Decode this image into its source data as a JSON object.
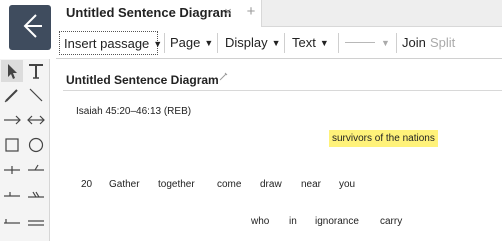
{
  "tab": {
    "title": "Untitled Sentence Diagram",
    "close_glyph": "×",
    "add_glyph": "+"
  },
  "toolbar": {
    "insert_passage": "Insert passage",
    "page": "Page",
    "display": "Display",
    "text": "Text",
    "join": "Join",
    "split": "Split",
    "caret_glyph": "▼"
  },
  "palette": {
    "tools": [
      "pointer-icon",
      "text-tool-icon",
      "pencil-icon",
      "line-icon",
      "arrow-icon",
      "double-arrow-icon",
      "rectangle-icon",
      "circle-icon",
      "horizontal-tick-icon",
      "slant-tick-icon",
      "baseline-icon",
      "slash-baseline-icon",
      "bracket-baseline-icon"
    ]
  },
  "canvas": {
    "doc_title": "Untitled Sentence Diagram",
    "reference": "Isaiah 45:20–46:13 (REB)",
    "highlighted_phrase": "survivors of the nations",
    "line1": [
      "20",
      "Gather",
      "together",
      "come",
      "draw",
      "near",
      "you"
    ],
    "line2": [
      "who",
      "in",
      "ignorance",
      "carry"
    ]
  },
  "colors": {
    "logo_bg": "#3f4c5e",
    "highlight": "#fff27a",
    "toolbar_disabled": "#aaaaaa"
  }
}
